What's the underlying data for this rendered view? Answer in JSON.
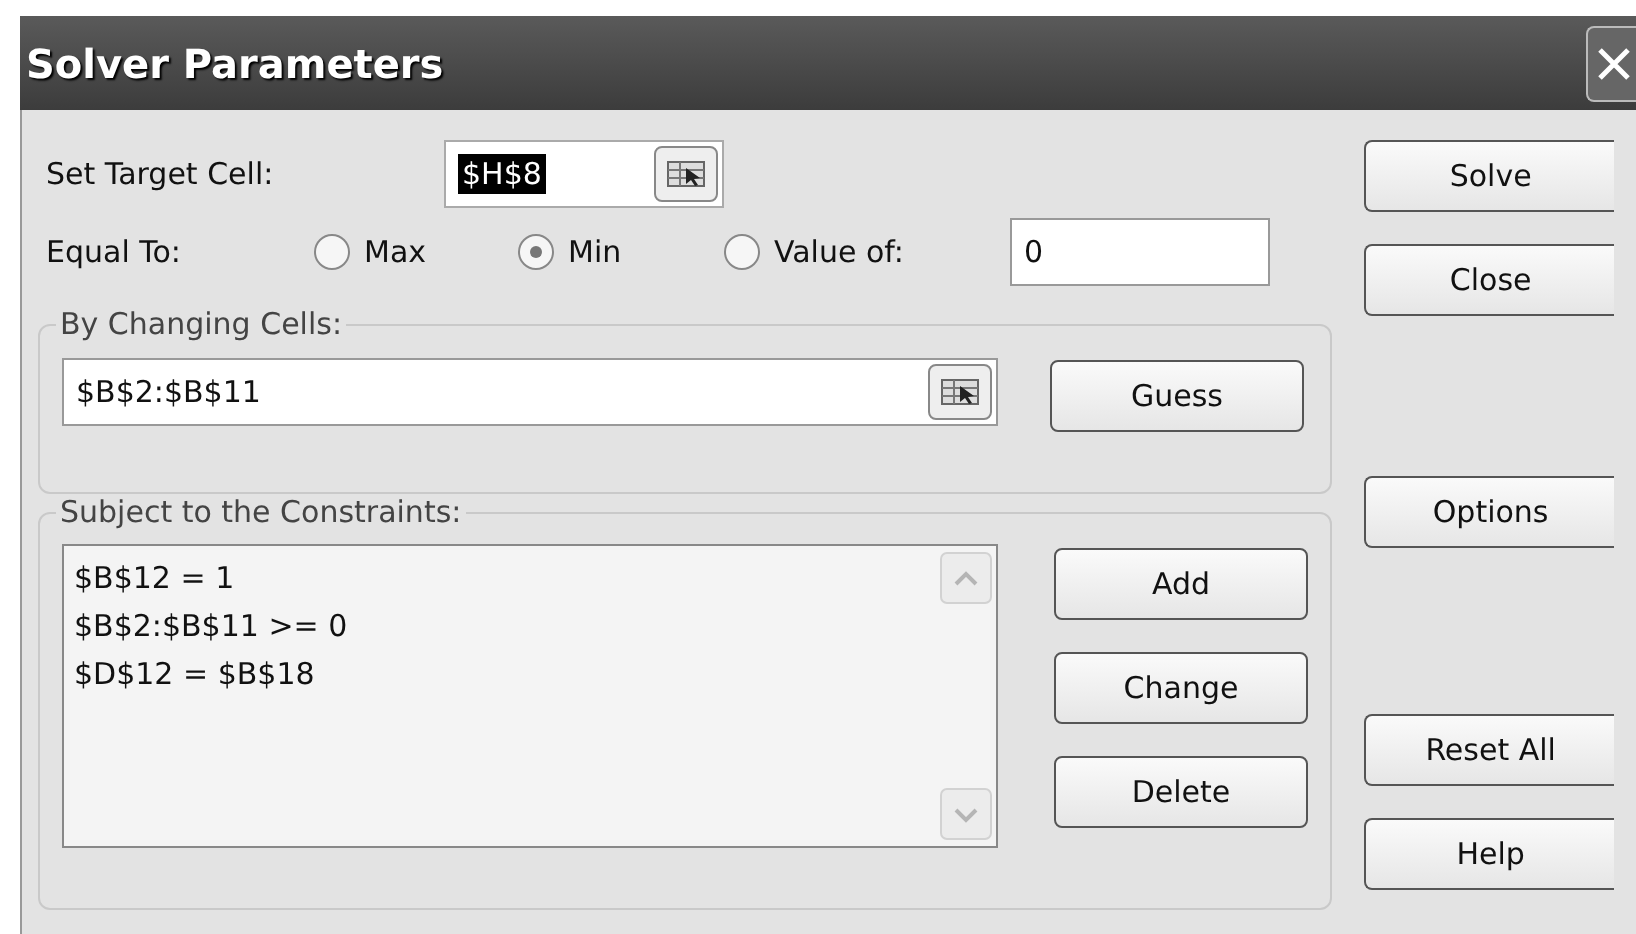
{
  "window": {
    "title": "Solver Parameters"
  },
  "target_cell": {
    "label": "Set Target Cell:",
    "value": "$H$8",
    "highlighted": true
  },
  "equal_to": {
    "label": "Equal To:",
    "options": [
      {
        "label": "Max",
        "selected": false
      },
      {
        "label": "Min",
        "selected": true
      },
      {
        "label": "Value of:",
        "selected": false
      }
    ],
    "value": "0"
  },
  "changing_cells": {
    "legend": "By Changing Cells:",
    "value": "$B$2:$B$11",
    "button": "Guess"
  },
  "constraints": {
    "legend": "Subject to the Constraints:",
    "items": [
      "$B$12 = 1",
      "$B$2:$B$11 >= 0",
      "$D$12 = $B$18"
    ],
    "buttons": [
      "Add",
      "Change",
      "Delete"
    ]
  },
  "side_buttons": [
    "Solve",
    "Close",
    "Options",
    "Reset All",
    "Help"
  ]
}
